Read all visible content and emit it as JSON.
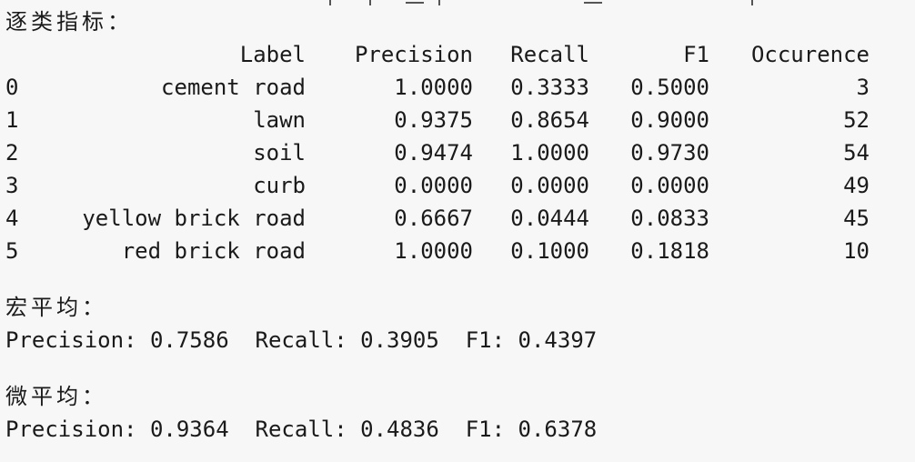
{
  "per_class": {
    "heading": "逐类指标：",
    "columns": [
      "Label",
      "Precision",
      "Recall",
      "F1",
      "Occurence"
    ],
    "rows": [
      {
        "idx": "0",
        "label": "cement road",
        "precision": "1.0000",
        "recall": "0.3333",
        "f1": "0.5000",
        "occurence": "3"
      },
      {
        "idx": "1",
        "label": "lawn",
        "precision": "0.9375",
        "recall": "0.8654",
        "f1": "0.9000",
        "occurence": "52"
      },
      {
        "idx": "2",
        "label": "soil",
        "precision": "0.9474",
        "recall": "1.0000",
        "f1": "0.9730",
        "occurence": "54"
      },
      {
        "idx": "3",
        "label": "curb",
        "precision": "0.0000",
        "recall": "0.0000",
        "f1": "0.0000",
        "occurence": "49"
      },
      {
        "idx": "4",
        "label": "yellow brick road",
        "precision": "0.6667",
        "recall": "0.0444",
        "f1": "0.0833",
        "occurence": "45"
      },
      {
        "idx": "5",
        "label": "red brick road",
        "precision": "1.0000",
        "recall": "0.1000",
        "f1": "0.1818",
        "occurence": "10"
      }
    ]
  },
  "macro": {
    "heading": "宏平均：",
    "line": "Precision: 0.7586  Recall: 0.3905  F1: 0.4397"
  },
  "micro": {
    "heading": "微平均：",
    "line": "Precision: 0.9364  Recall: 0.4836  F1: 0.6378"
  }
}
